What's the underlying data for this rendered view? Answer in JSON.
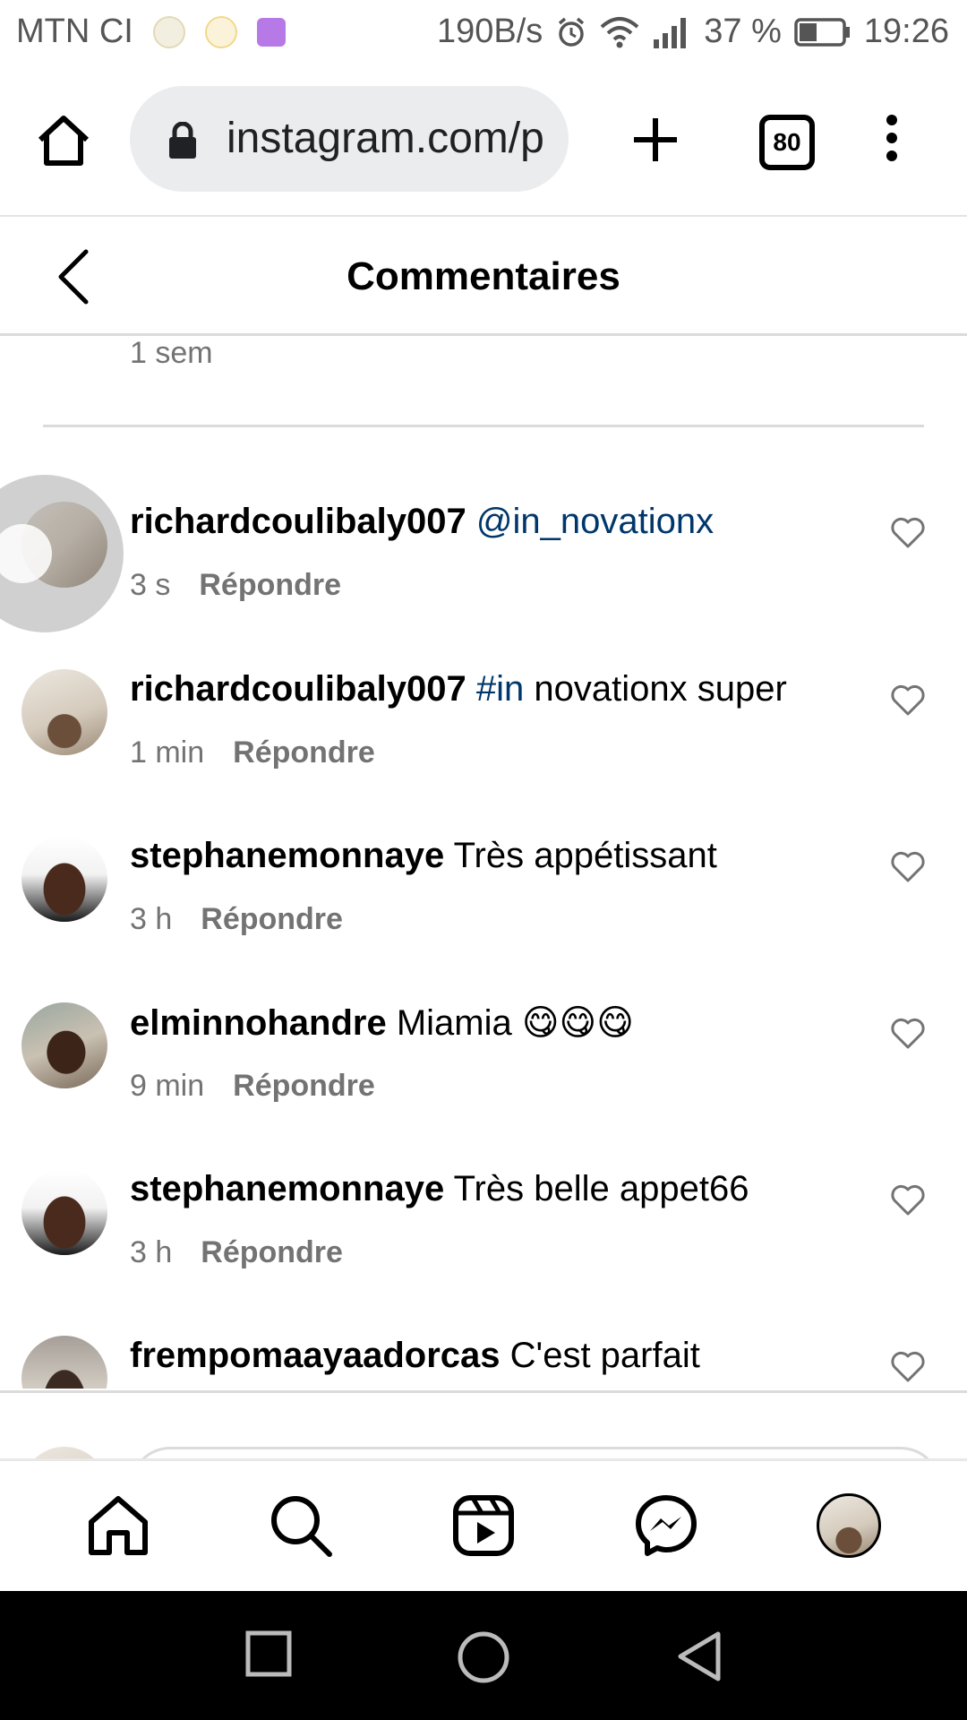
{
  "status_bar": {
    "carrier": "MTN CI",
    "speed": "190B/s",
    "battery": "37 %",
    "time": "19:26"
  },
  "browser": {
    "url": "instagram.com/p",
    "tab_count": "80"
  },
  "header": {
    "title": "Commentaires"
  },
  "comments": {
    "previous_time": "1 sem",
    "reply_label": "Répondre",
    "items": [
      {
        "username": "richardcoulibaly007",
        "tag": "@in_novationx",
        "text": "",
        "time": "3 s"
      },
      {
        "username": "richardcoulibaly007",
        "tag": "#in",
        "text": " novationx super",
        "time": "1 min"
      },
      {
        "username": "stephanemonnaye",
        "tag": "",
        "text": "Très appétissant",
        "time": "3 h"
      },
      {
        "username": "elminnohandre",
        "tag": "",
        "text": "Miamia 😋😋😋",
        "time": "9 min"
      },
      {
        "username": "stephanemonnaye",
        "tag": "",
        "text": "Très belle appet66",
        "time": "3 h"
      },
      {
        "username": "frempomaayaadorcas",
        "tag": "",
        "text": "C'est parfait",
        "time": ""
      }
    ]
  },
  "colors": {
    "hashtag": "#00376b",
    "meta_text": "#737373",
    "divider": "#dbdbdb"
  }
}
